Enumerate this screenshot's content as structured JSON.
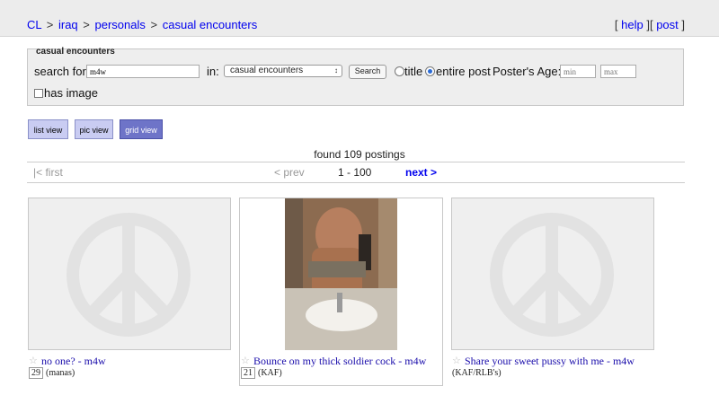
{
  "breadcrumb": {
    "cl": "CL",
    "city": "iraq",
    "section": "personals",
    "category": "casual encounters",
    "sep": ">"
  },
  "toplinks": {
    "help": "help",
    "post": "post",
    "lb": "[ ",
    "rb": " ]"
  },
  "search": {
    "legend": "casual encounters",
    "search_for_label": "search for:",
    "query": "m4w",
    "in_label": "in:",
    "category_value": "casual encounters",
    "search_button": "Search",
    "radio_title": "title",
    "radio_entire": "entire post",
    "age_label": "Poster's Age:",
    "min_placeholder": "min",
    "max_placeholder": "max",
    "has_image_label": "has image",
    "selected_scope": "entire post",
    "has_image_checked": false
  },
  "views": {
    "list": "list view",
    "pic": "pic view",
    "grid": "grid view",
    "active": "grid view"
  },
  "results": {
    "found": "found 109 postings"
  },
  "pager": {
    "first": "|< first",
    "prev": "< prev",
    "range": "1 - 100",
    "next": "next >"
  },
  "postings": [
    {
      "title": "no one? - m4w",
      "count": "29",
      "location": "(manas)",
      "image": "placeholder-peace"
    },
    {
      "title": "Bounce on my thick soldier cock - m4w",
      "count": "21",
      "location": "(KAF)",
      "image": "photo"
    },
    {
      "title": "Share your sweet pussy with me - m4w",
      "count": "",
      "location": "(KAF/RLB's)",
      "image": "placeholder-peace"
    }
  ],
  "icons": {
    "star": "star-icon",
    "peace": "peace-sign-icon"
  }
}
